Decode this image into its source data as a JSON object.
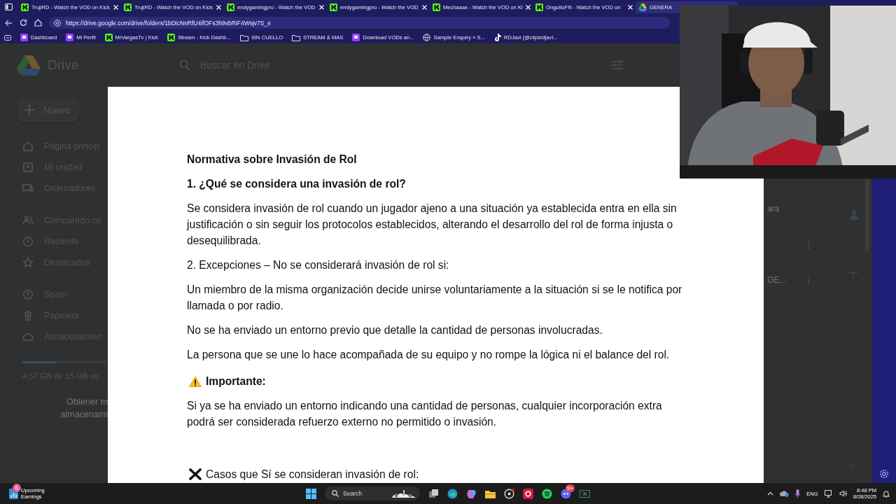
{
  "browser": {
    "tabs": [
      {
        "title": "TrujiRD - Watch the VOD on Kick",
        "kind": "kick",
        "selected": false
      },
      {
        "title": "TrujiRD - Watch the VOD on Kick",
        "kind": "kick",
        "selected": false
      },
      {
        "title": "endygamingpro - Watch the VOD",
        "kind": "kick",
        "selected": false
      },
      {
        "title": "endygamingpro - Watch the VOD",
        "kind": "kick",
        "selected": false
      },
      {
        "title": "Mechaaax - Watch the VOD on Ki",
        "kind": "kick",
        "selected": false
      },
      {
        "title": "OnguitoFN - Watch the VOD on",
        "kind": "kick",
        "selected": false
      },
      {
        "title": "GENERA",
        "kind": "drive",
        "selected": true
      }
    ],
    "url": "https://drive.google.com/drive/folders/1bDicNnRfU4ifOFs3h9vbRiF4Wsjv7S_e",
    "bookmarks": [
      {
        "label": "Dashboard",
        "kind": "twitch"
      },
      {
        "label": "Mi Perfil",
        "kind": "twitch"
      },
      {
        "label": "MrVargasTv | Kick",
        "kind": "kick"
      },
      {
        "label": "Stream - Kick Dashb...",
        "kind": "kick"
      },
      {
        "label": "SIN CUELLO",
        "kind": "folder"
      },
      {
        "label": "STREAM & MAS",
        "kind": "folder"
      },
      {
        "label": "Download VODs an...",
        "kind": "twitch"
      },
      {
        "label": "Sample Enquiry » S...",
        "kind": "globe"
      },
      {
        "label": "RDJavi (@clipsrdjavi...",
        "kind": "tiktok"
      }
    ]
  },
  "drive": {
    "app_name": "Drive",
    "search": {
      "placeholder": "Buscar en Drive"
    },
    "new_button": "Nuevo",
    "nav": [
      {
        "label": "Página princip",
        "kind": "home"
      },
      {
        "label": "Mi unidad",
        "kind": "drive"
      },
      {
        "label": "Ordenadores",
        "kind": "computer"
      },
      {
        "label": "Compartido co",
        "kind": "shared"
      },
      {
        "label": "Reciente",
        "kind": "recent"
      },
      {
        "label": "Destacados",
        "kind": "star"
      },
      {
        "label": "Spam",
        "kind": "spam"
      },
      {
        "label": "Papelera",
        "kind": "trash"
      },
      {
        "label": "Almacenamien",
        "kind": "cloud"
      }
    ],
    "storage": {
      "level": 0.4,
      "text": "4,57 GB de 15 GB us"
    },
    "storage_link": [
      "Obtener m",
      "almacenami"
    ],
    "fragments": [
      "ara",
      "GE..."
    ]
  },
  "document": {
    "blocks": [
      {
        "kind": "title",
        "text": "Normativa sobre Invasión de Rol"
      },
      {
        "kind": "heading",
        "text": "1. ¿Qué se considera una invasión de rol?"
      },
      {
        "kind": "text",
        "text": "Se considera invasión de rol cuando un jugador ajeno a una situación ya establecida entra en ella sin justificación o sin seguir los protocolos establecidos, alterando el desarrollo del rol de forma injusta o desequilibrada."
      },
      {
        "kind": "text",
        "text": "2. Excepciones – No se considerará invasión de rol si:"
      },
      {
        "kind": "text",
        "text": "Un miembro de la misma organización decide unirse voluntariamente a la situación si se le notifica por llamada o por radio."
      },
      {
        "kind": "text",
        "text": "No se ha enviado un entorno previo que detalle la cantidad de personas involucradas."
      },
      {
        "kind": "text",
        "text": "La persona que se une lo hace acompañada de su equipo y no rompe la lógica ni el balance del rol."
      },
      {
        "kind": "warning",
        "text": "Importante:"
      },
      {
        "kind": "text",
        "text": "Si ya se ha enviado un entorno indicando una cantidad de personas, cualquier incorporación extra podrá ser considerada refuerzo externo no permitido o invasión."
      },
      {
        "kind": "cross",
        "text": "Casos que Sí se consideran invasión de rol:"
      }
    ]
  },
  "taskbar": {
    "widget": {
      "title": "Upcoming",
      "subtitle": "Earnings",
      "badge": "6"
    },
    "search": "Search",
    "discord_badge": "9+",
    "language": "ENG",
    "time": "8:48 PM",
    "date": "8/28/2025"
  }
}
